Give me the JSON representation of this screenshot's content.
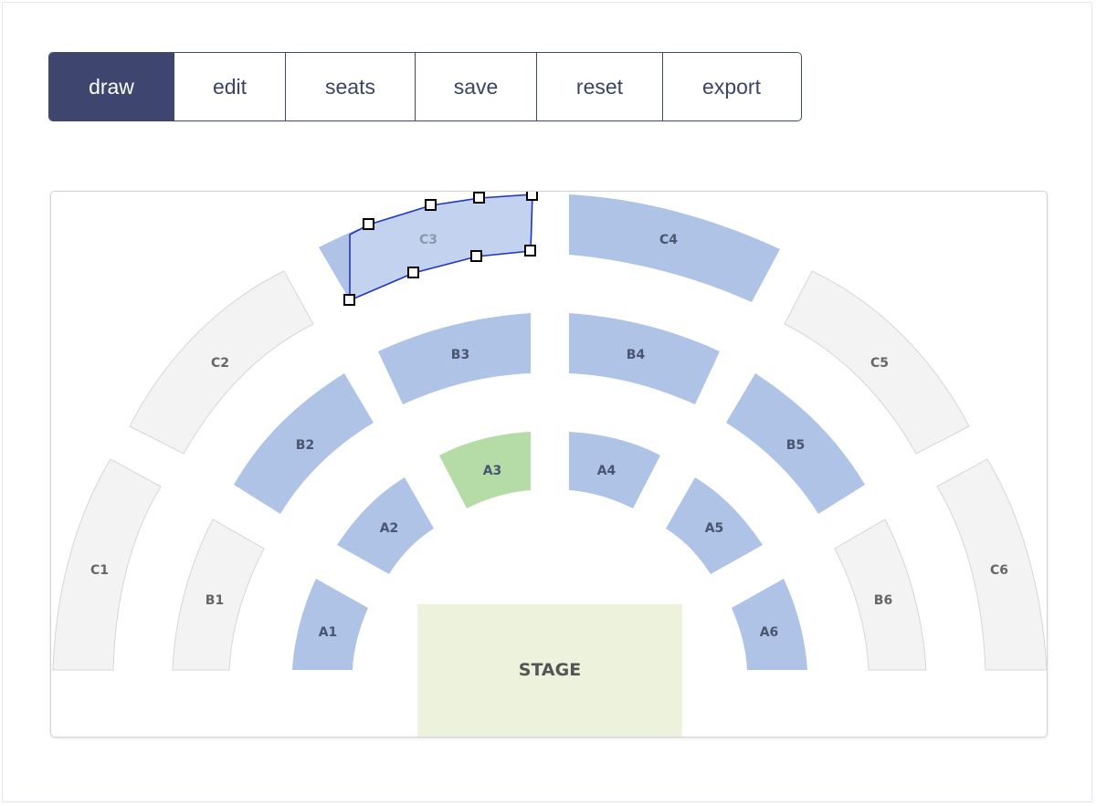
{
  "toolbar": {
    "buttons": [
      {
        "id": "draw",
        "label": "draw",
        "active": true
      },
      {
        "id": "edit",
        "label": "edit",
        "active": false
      },
      {
        "id": "seats",
        "label": "seats",
        "active": false
      },
      {
        "id": "save",
        "label": "save",
        "active": false
      },
      {
        "id": "reset",
        "label": "reset",
        "active": false
      },
      {
        "id": "export",
        "label": "export",
        "active": false
      }
    ]
  },
  "colors": {
    "toolbar_active_bg": "#3e4670",
    "toolbar_border": "#3f4a73",
    "section_blue": "#aec3e6",
    "section_green": "#b5dba6",
    "section_inactive": "#f3f3f3",
    "stage_fill": "#ecf2dc",
    "selection_stroke": "#1d35c8",
    "selection_fill": "#c7d5ee"
  },
  "seating_map": {
    "sections": {
      "A1": {
        "label": "A1",
        "state": "active"
      },
      "A2": {
        "label": "A2",
        "state": "active"
      },
      "A3": {
        "label": "A3",
        "state": "selected"
      },
      "A4": {
        "label": "A4",
        "state": "active"
      },
      "A5": {
        "label": "A5",
        "state": "active"
      },
      "A6": {
        "label": "A6",
        "state": "active"
      },
      "B1": {
        "label": "B1",
        "state": "inactive"
      },
      "B2": {
        "label": "B2",
        "state": "active"
      },
      "B3": {
        "label": "B3",
        "state": "active"
      },
      "B4": {
        "label": "B4",
        "state": "active"
      },
      "B5": {
        "label": "B5",
        "state": "active"
      },
      "B6": {
        "label": "B6",
        "state": "inactive"
      },
      "C1": {
        "label": "C1",
        "state": "inactive"
      },
      "C2": {
        "label": "C2",
        "state": "inactive"
      },
      "C3": {
        "label": "C3",
        "state": "editing"
      },
      "C4": {
        "label": "C4",
        "state": "active"
      },
      "C5": {
        "label": "C5",
        "state": "inactive"
      },
      "C6": {
        "label": "C6",
        "state": "inactive"
      }
    },
    "stage": {
      "label": "STAGE"
    }
  }
}
